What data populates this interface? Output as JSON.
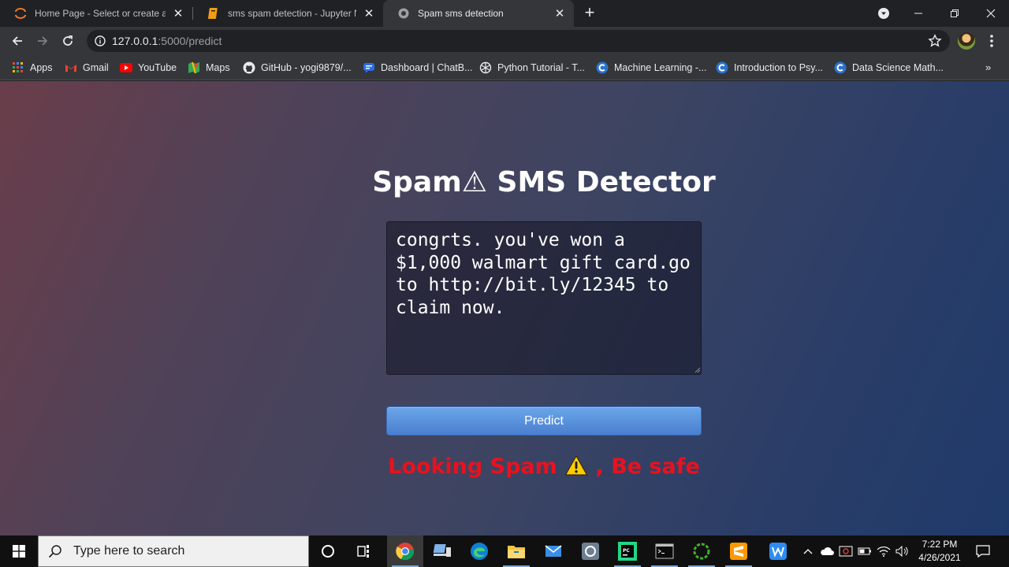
{
  "browser": {
    "tabs": [
      {
        "title": "Home Page - Select or create a n",
        "icon": "jupyter-icon",
        "active": false
      },
      {
        "title": "sms spam detection - Jupyter No",
        "icon": "notebook-icon",
        "active": false
      },
      {
        "title": "Spam sms detection",
        "icon": "globe-icon",
        "active": true
      }
    ],
    "address": {
      "host": "127.0.0.1",
      "path": ":5000/predict"
    },
    "bookmarks": [
      {
        "label": "Apps",
        "icon": "apps-grid-icon"
      },
      {
        "label": "Gmail",
        "icon": "gmail-icon"
      },
      {
        "label": "YouTube",
        "icon": "youtube-icon"
      },
      {
        "label": "Maps",
        "icon": "maps-icon"
      },
      {
        "label": "GitHub - yogi9879/...",
        "icon": "github-icon"
      },
      {
        "label": "Dashboard | ChatB...",
        "icon": "chatbot-icon"
      },
      {
        "label": "Python Tutorial - T...",
        "icon": "tutorial-icon"
      },
      {
        "label": "Machine Learning -...",
        "icon": "coursera-icon"
      },
      {
        "label": "Introduction to Psy...",
        "icon": "coursera-icon"
      },
      {
        "label": "Data Science Math...",
        "icon": "coursera-icon"
      }
    ],
    "more_bookmarks": "»"
  },
  "app": {
    "title": "Spam⚠ SMS Detector",
    "message": "congrts. you've won a $1,000 walmart gift card.go to http://bit.ly/12345 to claim now.",
    "predict_label": "Predict",
    "result_prefix": "Looking Spam ",
    "result_suffix": " , Be safe",
    "result_color": "#e8121e"
  },
  "taskbar": {
    "search_placeholder": "Type here to search",
    "time": "7:22 PM",
    "date": "4/26/2021"
  },
  "colors": {
    "page_gradient_start": "#6a3d4a",
    "page_gradient_end": "#1f3a6a",
    "button_blue": "#4a7fcf"
  }
}
